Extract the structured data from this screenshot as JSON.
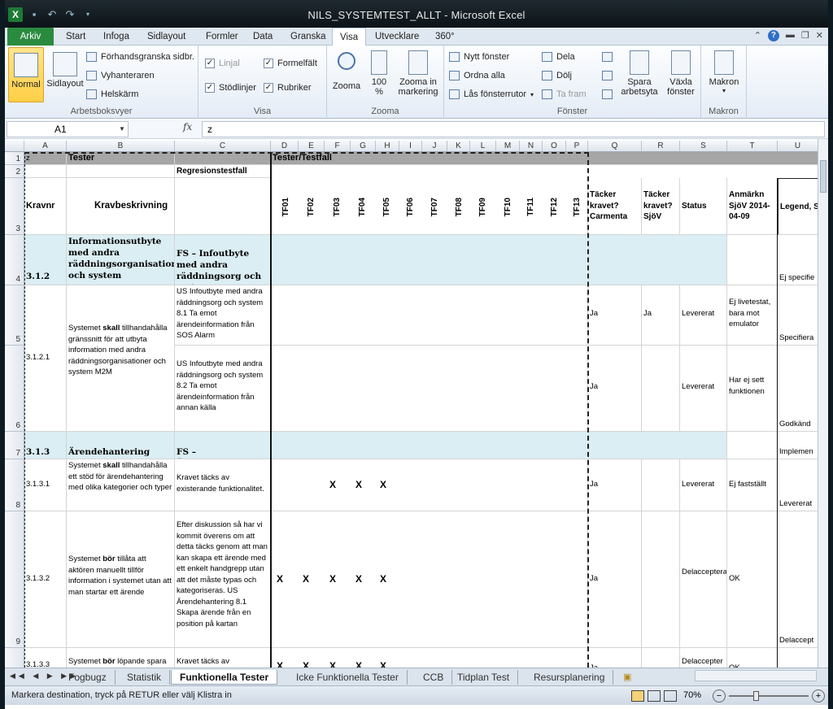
{
  "app": {
    "window_title": "NILS_SYSTEMTEST_ALLT - Microsoft Excel",
    "icon": "excel-icon"
  },
  "ribbon_tabs": [
    "Arkiv",
    "Start",
    "Infoga",
    "Sidlayout",
    "Formler",
    "Data",
    "Granska",
    "Visa",
    "Utvecklare",
    "360°"
  ],
  "active_tab": "Visa",
  "ribbon": {
    "arbetsboksvyer": {
      "label": "Arbetsboksvyer",
      "normal": "Normal",
      "sidlayout": "Sidlayout",
      "forhandsgranska": "Förhandsgranska sidbr.",
      "vyhanteraren": "Vyhanteraren",
      "helskarm": "Helskärm"
    },
    "visa": {
      "label": "Visa",
      "linjal": "Linjal",
      "stodlinjer": "Stödlinjer",
      "formelfalt": "Formelfält",
      "rubriker": "Rubriker"
    },
    "zooma": {
      "label": "Zooma",
      "zooma": "Zooma",
      "hundra_line1": "100",
      "hundra_line2": "%",
      "markering_line1": "Zooma in",
      "markering_line2": "markering"
    },
    "fonster": {
      "label": "Fönster",
      "nytt": "Nytt fönster",
      "ordna": "Ordna alla",
      "las": "Lås fönsterrutor",
      "dela": "Dela",
      "dolj": "Dölj",
      "ta_fram": "Ta fram",
      "spara_line1": "Spara",
      "spara_line2": "arbetsyta",
      "vaxla_line1": "Växla",
      "vaxla_line2": "fönster"
    },
    "makron": {
      "label": "Makron",
      "makron": "Makron"
    }
  },
  "formula_bar": {
    "name_box": "A1",
    "fx": "fx",
    "content": "z"
  },
  "columns": [
    "A",
    "B",
    "C",
    "D",
    "E",
    "F",
    "G",
    "H",
    "I",
    "J",
    "K",
    "L",
    "M",
    "N",
    "O",
    "P",
    "Q",
    "R",
    "S",
    "T",
    "U"
  ],
  "rows": [
    "1",
    "2",
    "3",
    "4",
    "5",
    "6",
    "7",
    "8",
    "9"
  ],
  "sheet": {
    "r1_a": "z",
    "r1_b": "Tester",
    "r1_d": "Tester/Testfall",
    "r2_c": "Regresionstestfall",
    "r3_a": "Kravnr",
    "r3_b": "Kravbeskrivning",
    "tf": [
      "TF01",
      "TF02",
      "TF03",
      "TF04",
      "TF05",
      "TF06",
      "TF07",
      "TF08",
      "TF09",
      "TF10",
      "TF11",
      "TF12",
      "TF13"
    ],
    "r3_q": "Täcker kravet? Carmenta",
    "r3_r": "Täcker kravet? SjöV",
    "r3_s": "Status",
    "r3_t": "Anmärkn SjöV 2014-04-09",
    "r3_u": "Legend, S",
    "r4_a": "3.1.2",
    "r4_b": "Informationsutbyte med andra räddningsorganisationer och system",
    "r4_c": "FS – Infoutbyte med andra räddningsorg och system",
    "r4_u": "Ej specifie",
    "r5_a": "3.1.2.1",
    "r5_b_pre": "Systemet ",
    "r5_b_bold": "skall",
    "r5_b_post": " tillhandahålla gränssnitt för att utbyta information med andra räddningsorganisationer och system M2M",
    "r5_c": "US Infoutbyte med andra räddningsorg och system 8.1 Ta emot ärendeinformation från SOS Alarm",
    "r5_q": "Ja",
    "r5_r": "Ja",
    "r5_s": "Levererat",
    "r5_t": "Ej livetestat, bara mot emulator",
    "r5_u": "Specifiera",
    "r6_c": "US Infoutbyte med andra räddningsorg och system 8.2 Ta emot ärendeinformation från annan källa",
    "r6_q": "Ja",
    "r6_s": "Levererat",
    "r6_t": "Har ej sett funktionen",
    "r6_u": "Godkänd",
    "r7_a": "3.1.3",
    "r7_b": "Ärendehantering",
    "r7_c": "FS – Ärendehantering",
    "r7_u": "Implemen",
    "r8_a": "3.1.3.1",
    "r8_b_pre": "Systemet ",
    "r8_b_bold": "skall",
    "r8_b_post": " tillhandahålla ett stöd för ärendehantering med olika kategorier och typer",
    "r8_c": "Kravet täcks av existerande funktionalitet.",
    "r8_x": "X",
    "r8_q": "Ja",
    "r8_s": "Levererat",
    "r8_t": "Ej fastställt",
    "r8_u": "Levererat",
    "r9_a": "3.1.3.2",
    "r9_b_pre": "Systemet ",
    "r9_b_bold": "bör",
    "r9_b_post": " tillåta att aktören manuellt tillför information i systemet utan att man startar ett ärende",
    "r9_c": "Efter diskussion så har vi kommit överens om att detta täcks genom att man kan skapa ett ärende med ett enkelt handgrepp utan att det måste typas och kategoriseras. US Ärendehantering 8.1 Skapa ärende från en position på kartan",
    "r9_q": "Ja",
    "r9_s": "Delaccepterat",
    "r9_t": "OK",
    "r9_u": "Delaccept",
    "r10_a": "3.1.3.3",
    "r10_b_pre": "Systemet ",
    "r10_b_bold": "bör",
    "r10_b_post": " löpande spara",
    "r10_c": "Kravet täcks av",
    "r10_q": "Ja",
    "r10_s": "Delaccepter",
    "r10_t": "OK"
  },
  "sheet_tabs": [
    "Fogbugz",
    "Statistik",
    "Funktionella Tester",
    "Icke Funktionella Tester",
    "CCB",
    "Tidplan Test",
    "Resursplanering"
  ],
  "active_sheet": "Funktionella Tester",
  "status": {
    "text": "Markera destination, tryck på RETUR eller välj Klistra in",
    "zoom": "70%"
  }
}
